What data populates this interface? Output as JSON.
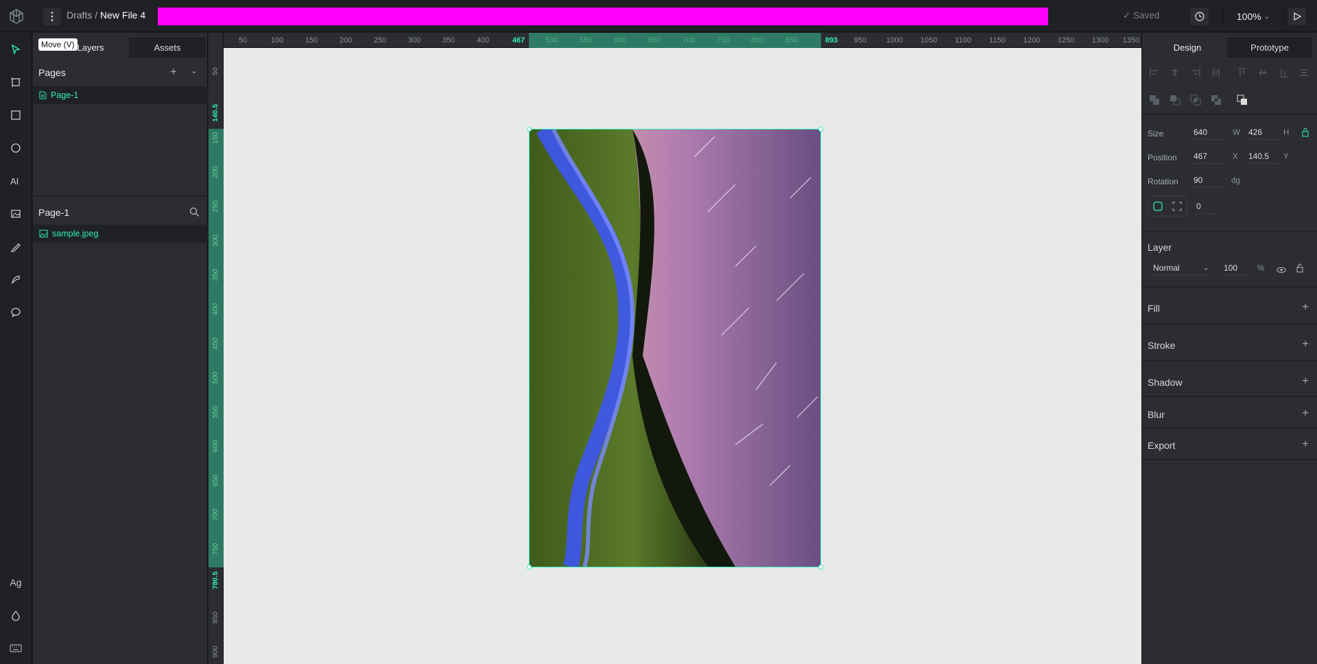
{
  "header": {
    "breadcrumb_root": "Drafts",
    "breadcrumb_sep": "/",
    "file_name": "New File 4",
    "saved_label": "Saved",
    "zoom_label": "100%",
    "highlight_color": "#ff00ff"
  },
  "toolbar": {
    "tooltip": "Move (V)",
    "tools": [
      "move-icon",
      "board-icon",
      "rectangle-icon",
      "ellipse-icon",
      "text-icon",
      "image-icon",
      "curve-icon",
      "path-icon",
      "comments-icon"
    ],
    "bottom_tools": [
      "typography-icon",
      "color-palette-icon",
      "shortcuts-icon"
    ],
    "typography_label": "Ag"
  },
  "layers_panel": {
    "tabs": [
      "Layers",
      "Assets"
    ],
    "pages_title": "Pages",
    "pages": [
      "Page-1"
    ],
    "current_page": "Page-1",
    "layers": [
      "sample.jpeg"
    ]
  },
  "rulers": {
    "top_ticks": [
      "50",
      "100",
      "150",
      "200",
      "250",
      "300",
      "350",
      "400",
      "467",
      "500",
      "550",
      "600",
      "650",
      "700",
      "750",
      "800",
      "850",
      "893",
      "950",
      "1000",
      "1050",
      "1100",
      "1150",
      "1200",
      "1250",
      "1300",
      "1350"
    ],
    "left_ticks": [
      "50",
      "140.5",
      "150",
      "200",
      "250",
      "300",
      "350",
      "400",
      "450",
      "500",
      "550",
      "600",
      "650",
      "700",
      "750",
      "780.5",
      "850",
      "900"
    ],
    "selection_start_x": "467",
    "selection_end_x": "893",
    "selection_start_y": "140.5",
    "selection_end_y": "780.5"
  },
  "design_panel": {
    "tabs": [
      "Design",
      "Prototype"
    ],
    "size_label": "Size",
    "width": "640",
    "width_unit": "W",
    "height": "426",
    "height_unit": "H",
    "position_label": "Position",
    "pos_x": "467",
    "pos_x_unit": "X",
    "pos_y": "140.5",
    "pos_y_unit": "Y",
    "rotation_label": "Rotation",
    "rotation": "90",
    "rotation_unit": "dg",
    "radius": "0",
    "layer_title": "Layer",
    "blend_mode": "Normal",
    "opacity": "100",
    "opacity_unit": "%",
    "sections": [
      "Fill",
      "Stroke",
      "Shadow",
      "Blur",
      "Export"
    ]
  },
  "colors": {
    "accent": "#31efb8",
    "panel": "#2b2d31",
    "canvas": "#e8e9ea"
  }
}
